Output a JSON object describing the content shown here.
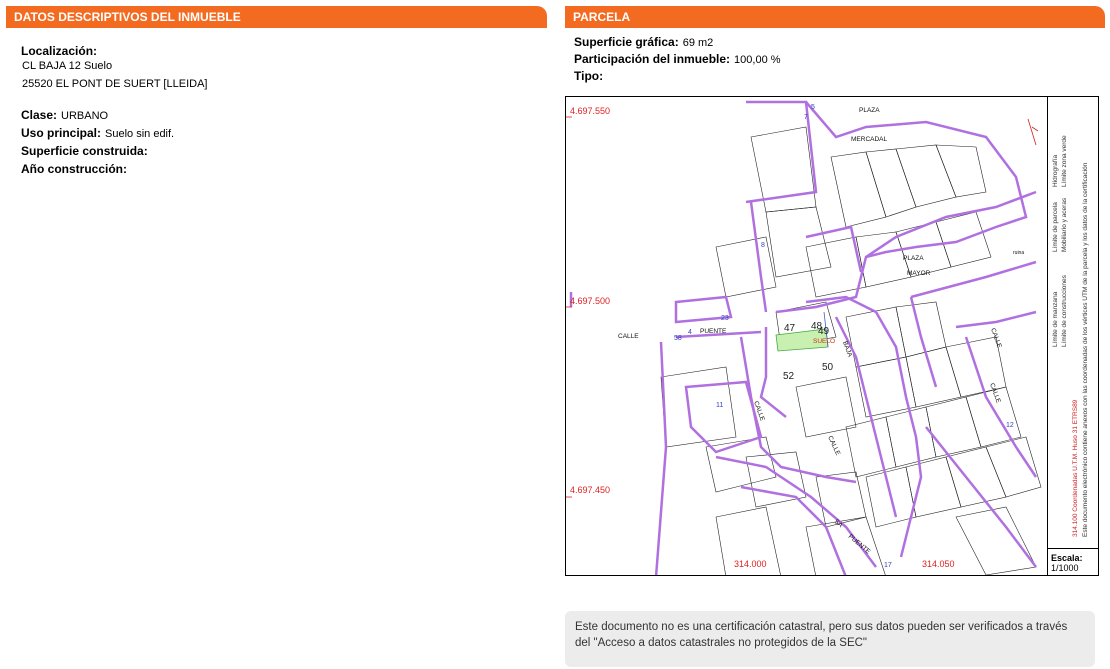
{
  "left_panel": {
    "header": "DATOS DESCRIPTIVOS DEL INMUEBLE",
    "localizacion_label": "Localización:",
    "address_line1": "CL BAJA 12 Suelo",
    "address_line2": "25520 EL PONT DE SUERT [LLEIDA]",
    "clase_label": "Clase:",
    "clase_value": "URBANO",
    "uso_label": "Uso principal:",
    "uso_value": "Suelo sin edif.",
    "superficie_label": "Superficie construida:",
    "anio_label": "Año construcción:"
  },
  "right_panel": {
    "header": "PARCELA",
    "superficie_label": "Superficie gráfica:",
    "superficie_value": "69 m2",
    "participacion_label": "Participación del inmueble:",
    "participacion_value": "100,00 %",
    "tipo_label": "Tipo:"
  },
  "map": {
    "coord_y1": "4.697.550",
    "coord_y2": "4.697.500",
    "coord_y3": "4.697.450",
    "coord_x1": "314.000",
    "coord_x2": "314.050",
    "labels": {
      "plaza1": "PLAZA",
      "mercadal": "MERCADAL",
      "plaza2": "PLAZA",
      "mayor": "MAYOR",
      "calle_left": "CALLE",
      "puente1": "PUENTE",
      "suelo": "SUELO",
      "baja": "BAJA",
      "calle2": "CALLE",
      "calle3": "CALLE",
      "calle4": "CALLE",
      "calle5": "CALLE",
      "puente2": "PUENTE",
      "sa": "SA",
      "ruina": "ruina",
      "n47": "47",
      "n48": "48",
      "n49": "49",
      "n50": "50",
      "n52": "52",
      "n11": "11",
      "n58": "58",
      "n23": "23",
      "n4": "4",
      "n5": "5",
      "n7": "7",
      "n8": "8",
      "n12": "12",
      "n17": "17"
    },
    "legend": {
      "line1": "Límite de manzana",
      "line2": "Límite de parcela",
      "line3": "Hidrografía",
      "line4": "Límite de construcciones",
      "line5": "Mobiliario y aceras",
      "line6": "Límite zona verde",
      "coords_note": "314.100 Coordenadas U.T.M. Huso 31 ETRS89",
      "doc_note": "Este documento electrónico contiene anexos con las coordenadas de los vértices UTM de la parcela y los datos de la certificación"
    },
    "scale_label": "Escala:",
    "scale_value": "1/1000"
  },
  "footer_note": "Este documento no es una certificación catastral, pero sus datos pueden ser verificados a través del \"Acceso a datos catastrales no protegidos de la SEC\"",
  "colors": {
    "accent": "#f26b21",
    "manzana": "#b070e0",
    "parcela_highlight": "#c8f0b0",
    "coord_red": "#e02020"
  }
}
